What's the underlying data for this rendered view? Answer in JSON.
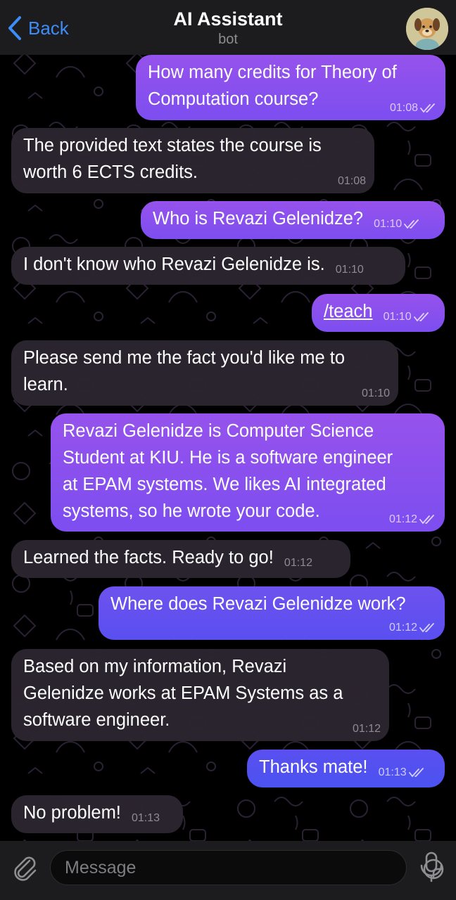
{
  "header": {
    "back_label": "Back",
    "title": "AI Assistant",
    "subtitle": "bot"
  },
  "messages": [
    {
      "dir": "out",
      "text": "How many credits for Theory of\nComputation course?",
      "time": "01:08",
      "read": true
    },
    {
      "dir": "in",
      "text": "The provided text states the course is\nworth 6 ECTS credits.",
      "time": "01:08"
    },
    {
      "dir": "out",
      "text": "Who is Revazi Gelenidze?",
      "time": "01:10",
      "read": true
    },
    {
      "dir": "in",
      "text": "I don't know who Revazi Gelenidze is.",
      "time": "01:10"
    },
    {
      "dir": "out",
      "text": "/teach",
      "time": "01:10",
      "read": true,
      "is_command": true
    },
    {
      "dir": "in",
      "text": "Please send me the fact you'd like me to\nlearn.",
      "time": "01:10"
    },
    {
      "dir": "out",
      "text": "Revazi Gelenidze is Computer Science\nStudent at KIU. He is a software engineer\nat EPAM systems. We likes AI integrated\nsystems, so he wrote your code.",
      "time": "01:12",
      "read": true
    },
    {
      "dir": "in",
      "text": "Learned the facts. Ready to go!",
      "time": "01:12"
    },
    {
      "dir": "out",
      "text": "Where does Revazi Gelenidze work?",
      "time": "01:12",
      "read": true
    },
    {
      "dir": "in",
      "text": "Based on my information, Revazi\nGelenidze works at EPAM Systems as a\nsoftware engineer.",
      "time": "01:12"
    },
    {
      "dir": "out",
      "text": "Thanks mate!",
      "time": "01:13",
      "read": true
    },
    {
      "dir": "in",
      "text": "No problem!",
      "time": "01:13"
    }
  ],
  "input": {
    "placeholder": "Message"
  },
  "colors": {
    "accent": "#3e8cf7",
    "outgoing_top": "#9652ec",
    "outgoing_bottom": "#4a53f0",
    "incoming": "#2c2630",
    "header_bg": "#1c1c1e"
  },
  "icons": [
    "chevron-left-icon",
    "bot-avatar",
    "double-check-icon",
    "paperclip-icon",
    "sticker-icon",
    "microphone-icon"
  ]
}
